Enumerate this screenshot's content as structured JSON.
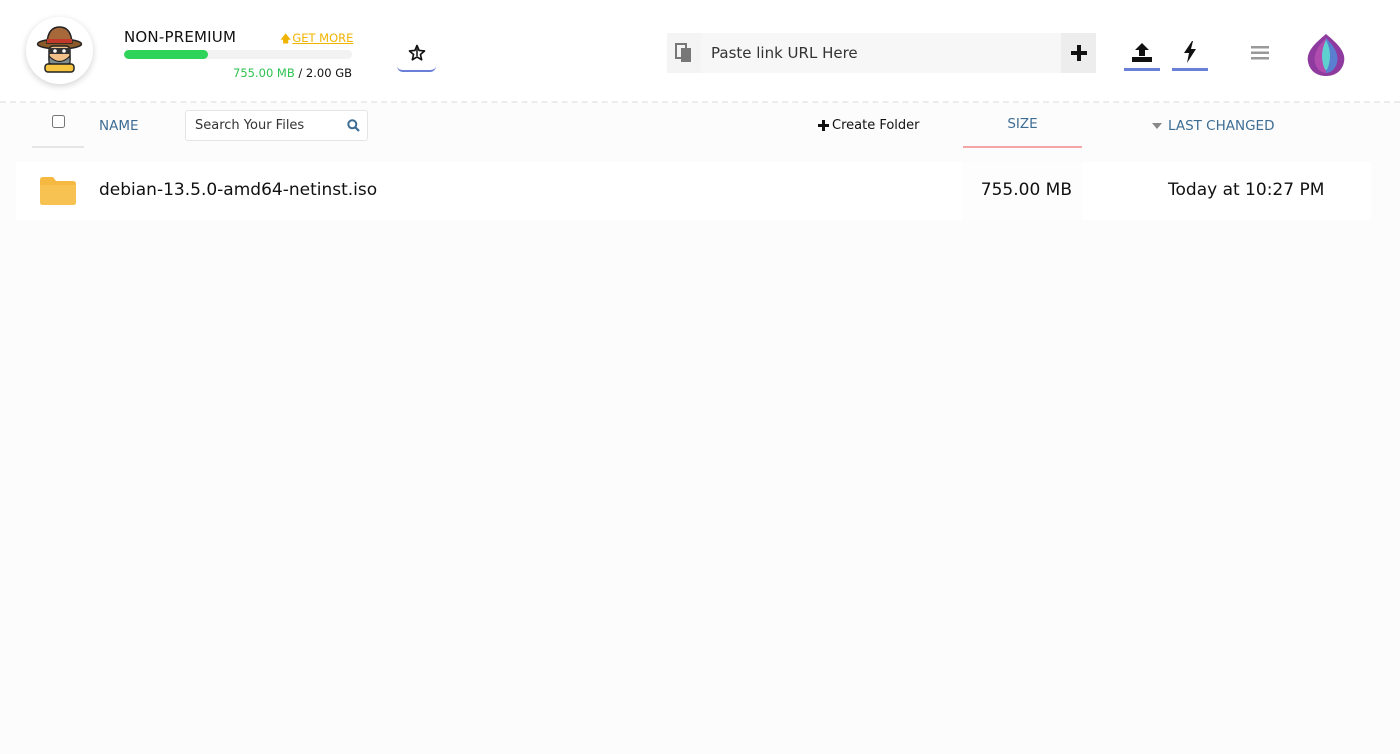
{
  "account": {
    "plan": "NON-PREMIUM",
    "get_more": "GET MORE",
    "storage_used": "755.00 MB",
    "storage_total": "/ 2.00 GB",
    "storage_fraction": 0.369
  },
  "url_bar": {
    "placeholder": "Paste link URL Here"
  },
  "table": {
    "col_name": "NAME",
    "search_placeholder": "Search Your Files",
    "create_folder": "Create Folder",
    "col_size": "SIZE",
    "col_last_changed": "LAST CHANGED"
  },
  "files": [
    {
      "name": "debian-13.5.0-amd64-netinst.iso",
      "size": "755.00 MB",
      "last_changed": "Today at 10:27 PM",
      "icon": "folder-icon"
    }
  ],
  "colors": {
    "accent_blue": "#6a7fd8",
    "storage_green": "#2ed35a",
    "get_more_yellow": "#f0b400",
    "column_text": "#3e6d94",
    "size_underline": "#f4a6a6",
    "folder": "#f5b941"
  },
  "icons": {
    "avatar": "cowboy-ninja-avatar",
    "favorites": "star-icon",
    "paste": "paste-icon",
    "add": "plus-icon",
    "upload": "upload-icon",
    "flash": "lightning-icon",
    "menu": "hamburger-icon",
    "logo": "lotus-logo",
    "search": "search-icon",
    "sort": "caret-down-icon"
  }
}
